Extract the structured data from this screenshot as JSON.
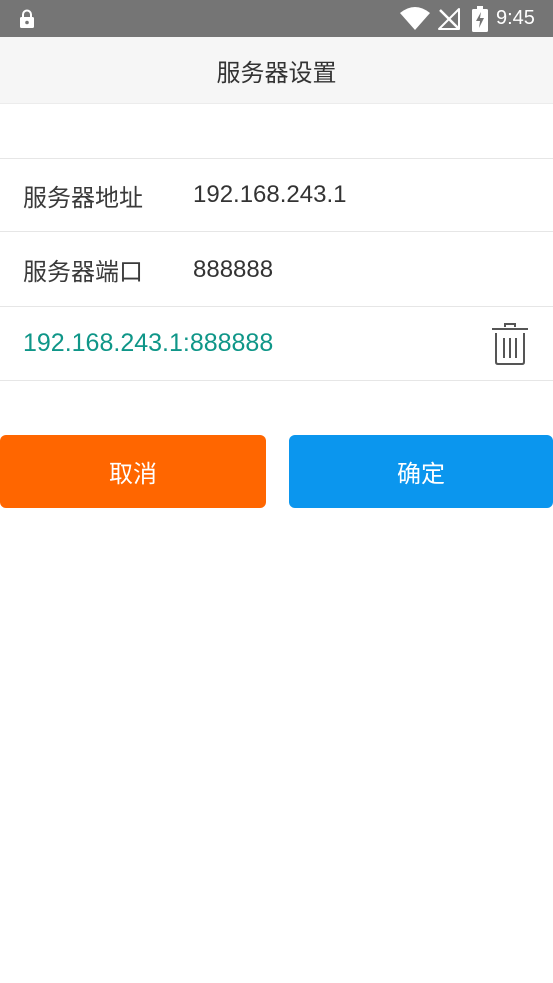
{
  "status_bar": {
    "time": "9:45",
    "icons": [
      "lock-icon",
      "wifi-icon",
      "signal-off-icon",
      "battery-charging-icon"
    ]
  },
  "header": {
    "title": "服务器设置"
  },
  "form": {
    "address": {
      "label": "服务器地址",
      "value": "192.168.243.1"
    },
    "port": {
      "label": "服务器端口",
      "value": "888888"
    }
  },
  "history": [
    {
      "entry": "192.168.243.1:888888",
      "icon": "trash-icon"
    }
  ],
  "buttons": {
    "cancel_label": "取消",
    "confirm_label": "确定"
  },
  "colors": {
    "status_bar": "#757575",
    "history_text": "#0f9688",
    "cancel": "#ff6600",
    "confirm": "#0b96ee"
  }
}
